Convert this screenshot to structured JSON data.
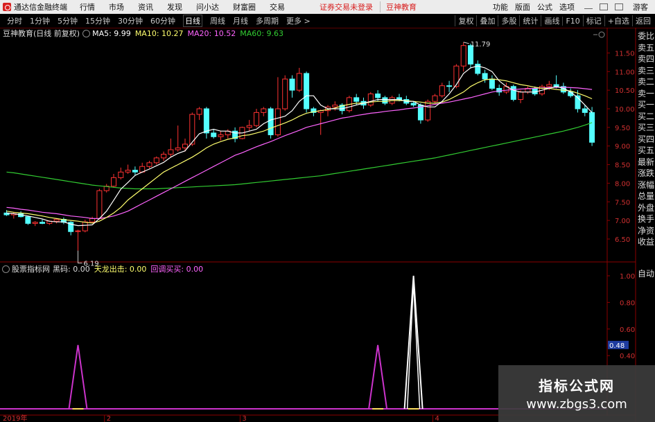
{
  "menubar": {
    "app_title": "通达信金融终端",
    "items": [
      "行情",
      "市场",
      "资讯",
      "发现",
      "问小达",
      "财富圈",
      "交易"
    ],
    "warning": "证券交易未登录",
    "brand": "豆神教育",
    "right_items": [
      "功能",
      "版面",
      "公式",
      "选项"
    ],
    "right_user": "游客"
  },
  "toolbar": {
    "periods": [
      "分时",
      "1分钟",
      "5分钟",
      "15分钟",
      "30分钟",
      "60分钟",
      "日线",
      "周线",
      "月线",
      "多周期",
      "更多 >"
    ],
    "active_period": "日线",
    "right": [
      "复权",
      "叠加",
      "多股",
      "统计",
      "画线",
      "F10",
      "标记",
      "+自选",
      "返回"
    ]
  },
  "infobar": {
    "stock": "豆神教育(日线 前复权)",
    "ma5": "MA5: 9.99",
    "ma10": "MA10: 10.27",
    "ma20": "MA20: 10.52",
    "ma60": "MA60: 9.63"
  },
  "indicator_bar": {
    "name": "股票指标网",
    "black_horse": "黑码: 0.00",
    "dragon": "天龙出击: 0.00",
    "pullback": "回调买买: 0.00"
  },
  "price_axis": [
    "11.50",
    "11.00",
    "10.50",
    "10.00",
    "9.50",
    "9.00",
    "8.50",
    "8.00",
    "7.50",
    "7.00",
    "6.50"
  ],
  "indicator_axis": [
    "1.00",
    "0.80",
    "0.60",
    "0.40"
  ],
  "indicator_marker": "0.48",
  "annotations": {
    "high": "11.79",
    "low": "6.19"
  },
  "date_axis": [
    "2019年",
    "2",
    "3",
    "4"
  ],
  "side_panel": [
    "委比",
    "卖五",
    "卖四",
    "卖三",
    "卖二",
    "卖一",
    "买一",
    "买二",
    "买三",
    "买四",
    "买五",
    "最新",
    "涨跌",
    "涨幅",
    "总量",
    "外盘",
    "换手",
    "净资",
    "收益"
  ],
  "auto_label": "自动",
  "watermark": {
    "title": "指标公式网",
    "url": "www.zbgs3.com"
  },
  "colors": {
    "up": "#ff3232",
    "down": "#54ffff",
    "ma5": "#ffffff",
    "ma10": "#ffff6e",
    "ma20": "#ff64ff",
    "ma60": "#32cd32",
    "signal_pink": "#cc33cc",
    "signal_white": "#ffffff"
  },
  "chart_data": {
    "type": "candlestick",
    "price_range": [
      6.2,
      11.95
    ],
    "candles": [
      {
        "o": 7.2,
        "h": 7.28,
        "l": 7.12,
        "c": 7.15
      },
      {
        "o": 7.15,
        "h": 7.22,
        "l": 7.05,
        "c": 7.18
      },
      {
        "o": 7.18,
        "h": 7.25,
        "l": 7.08,
        "c": 7.1
      },
      {
        "o": 7.1,
        "h": 7.12,
        "l": 6.88,
        "c": 6.92
      },
      {
        "o": 6.92,
        "h": 6.98,
        "l": 6.85,
        "c": 6.95
      },
      {
        "o": 6.95,
        "h": 7.02,
        "l": 6.9,
        "c": 6.92
      },
      {
        "o": 6.92,
        "h": 7.0,
        "l": 6.88,
        "c": 6.98
      },
      {
        "o": 6.98,
        "h": 7.05,
        "l": 6.92,
        "c": 7.03
      },
      {
        "o": 7.03,
        "h": 7.08,
        "l": 6.9,
        "c": 6.95
      },
      {
        "o": 6.95,
        "h": 6.98,
        "l": 6.6,
        "c": 6.7
      },
      {
        "o": 6.7,
        "h": 6.75,
        "l": 6.19,
        "c": 6.72
      },
      {
        "o": 6.72,
        "h": 7.02,
        "l": 6.68,
        "c": 6.96
      },
      {
        "o": 6.96,
        "h": 7.1,
        "l": 6.92,
        "c": 7.05
      },
      {
        "o": 7.05,
        "h": 7.85,
        "l": 7.02,
        "c": 7.8
      },
      {
        "o": 7.8,
        "h": 7.98,
        "l": 7.75,
        "c": 7.92
      },
      {
        "o": 7.92,
        "h": 8.25,
        "l": 7.88,
        "c": 8.15
      },
      {
        "o": 8.15,
        "h": 8.42,
        "l": 8.1,
        "c": 8.3
      },
      {
        "o": 8.3,
        "h": 8.5,
        "l": 8.25,
        "c": 8.35
      },
      {
        "o": 8.35,
        "h": 8.45,
        "l": 8.2,
        "c": 8.3
      },
      {
        "o": 8.3,
        "h": 8.55,
        "l": 8.28,
        "c": 8.45
      },
      {
        "o": 8.45,
        "h": 8.6,
        "l": 8.4,
        "c": 8.55
      },
      {
        "o": 8.55,
        "h": 8.72,
        "l": 8.5,
        "c": 8.68
      },
      {
        "o": 8.68,
        "h": 8.85,
        "l": 8.6,
        "c": 8.78
      },
      {
        "o": 8.78,
        "h": 9.2,
        "l": 8.7,
        "c": 8.9
      },
      {
        "o": 8.9,
        "h": 9.55,
        "l": 8.85,
        "c": 8.95
      },
      {
        "o": 8.95,
        "h": 9.2,
        "l": 8.85,
        "c": 9.05
      },
      {
        "o": 9.05,
        "h": 9.9,
        "l": 9.0,
        "c": 9.85
      },
      {
        "o": 9.85,
        "h": 10.05,
        "l": 9.7,
        "c": 10.0
      },
      {
        "o": 10.0,
        "h": 10.05,
        "l": 9.2,
        "c": 9.35
      },
      {
        "o": 9.35,
        "h": 9.45,
        "l": 9.2,
        "c": 9.25
      },
      {
        "o": 9.25,
        "h": 9.4,
        "l": 9.15,
        "c": 9.3
      },
      {
        "o": 9.3,
        "h": 9.45,
        "l": 9.2,
        "c": 9.4
      },
      {
        "o": 9.4,
        "h": 9.5,
        "l": 9.1,
        "c": 9.2
      },
      {
        "o": 9.2,
        "h": 9.52,
        "l": 9.18,
        "c": 9.5
      },
      {
        "o": 9.5,
        "h": 9.7,
        "l": 9.4,
        "c": 9.55
      },
      {
        "o": 9.55,
        "h": 10.0,
        "l": 9.5,
        "c": 9.9
      },
      {
        "o": 9.9,
        "h": 10.05,
        "l": 9.8,
        "c": 10.0
      },
      {
        "o": 10.0,
        "h": 10.05,
        "l": 9.2,
        "c": 9.3
      },
      {
        "o": 9.3,
        "h": 10.85,
        "l": 9.25,
        "c": 10.0
      },
      {
        "o": 10.0,
        "h": 10.9,
        "l": 9.95,
        "c": 10.8
      },
      {
        "o": 10.8,
        "h": 10.9,
        "l": 10.3,
        "c": 10.5
      },
      {
        "o": 10.5,
        "h": 11.1,
        "l": 10.45,
        "c": 10.95
      },
      {
        "o": 10.95,
        "h": 11.0,
        "l": 9.9,
        "c": 10.0
      },
      {
        "o": 10.0,
        "h": 10.05,
        "l": 9.8,
        "c": 9.9
      },
      {
        "o": 9.9,
        "h": 9.98,
        "l": 9.3,
        "c": 9.95
      },
      {
        "o": 9.95,
        "h": 10.1,
        "l": 9.8,
        "c": 10.05
      },
      {
        "o": 10.05,
        "h": 10.2,
        "l": 9.95,
        "c": 10.1
      },
      {
        "o": 10.1,
        "h": 10.15,
        "l": 9.85,
        "c": 9.95
      },
      {
        "o": 9.95,
        "h": 10.35,
        "l": 9.9,
        "c": 10.3
      },
      {
        "o": 10.3,
        "h": 10.4,
        "l": 10.1,
        "c": 10.2
      },
      {
        "o": 10.2,
        "h": 10.3,
        "l": 10.0,
        "c": 10.1
      },
      {
        "o": 10.1,
        "h": 10.45,
        "l": 10.05,
        "c": 10.4
      },
      {
        "o": 10.4,
        "h": 10.5,
        "l": 10.2,
        "c": 10.3
      },
      {
        "o": 10.3,
        "h": 10.35,
        "l": 10.1,
        "c": 10.15
      },
      {
        "o": 10.15,
        "h": 10.35,
        "l": 10.1,
        "c": 10.3
      },
      {
        "o": 10.3,
        "h": 10.4,
        "l": 10.2,
        "c": 10.25
      },
      {
        "o": 10.25,
        "h": 10.35,
        "l": 10.1,
        "c": 10.15
      },
      {
        "o": 10.15,
        "h": 10.2,
        "l": 10.05,
        "c": 10.1
      },
      {
        "o": 10.1,
        "h": 10.15,
        "l": 9.6,
        "c": 9.7
      },
      {
        "o": 9.7,
        "h": 10.25,
        "l": 9.65,
        "c": 10.2
      },
      {
        "o": 10.2,
        "h": 10.4,
        "l": 10.15,
        "c": 10.35
      },
      {
        "o": 10.35,
        "h": 10.7,
        "l": 10.3,
        "c": 10.62
      },
      {
        "o": 10.62,
        "h": 10.75,
        "l": 10.45,
        "c": 10.6
      },
      {
        "o": 10.6,
        "h": 11.2,
        "l": 10.55,
        "c": 11.15
      },
      {
        "o": 11.15,
        "h": 11.79,
        "l": 11.0,
        "c": 11.7
      },
      {
        "o": 11.7,
        "h": 11.75,
        "l": 11.1,
        "c": 11.2
      },
      {
        "o": 11.2,
        "h": 11.3,
        "l": 10.9,
        "c": 10.95
      },
      {
        "o": 10.95,
        "h": 11.05,
        "l": 10.7,
        "c": 10.8
      },
      {
        "o": 10.8,
        "h": 10.9,
        "l": 10.5,
        "c": 10.55
      },
      {
        "o": 10.55,
        "h": 10.65,
        "l": 10.35,
        "c": 10.45
      },
      {
        "o": 10.45,
        "h": 10.7,
        "l": 10.4,
        "c": 10.6
      },
      {
        "o": 10.6,
        "h": 10.65,
        "l": 10.2,
        "c": 10.25
      },
      {
        "o": 10.25,
        "h": 10.5,
        "l": 10.15,
        "c": 10.45
      },
      {
        "o": 10.45,
        "h": 10.6,
        "l": 10.4,
        "c": 10.55
      },
      {
        "o": 10.55,
        "h": 10.6,
        "l": 10.35,
        "c": 10.4
      },
      {
        "o": 10.4,
        "h": 10.65,
        "l": 10.35,
        "c": 10.6
      },
      {
        "o": 10.6,
        "h": 10.75,
        "l": 10.5,
        "c": 10.65
      },
      {
        "o": 10.65,
        "h": 10.9,
        "l": 10.55,
        "c": 10.6
      },
      {
        "o": 10.6,
        "h": 10.7,
        "l": 10.4,
        "c": 10.45
      },
      {
        "o": 10.45,
        "h": 10.55,
        "l": 10.3,
        "c": 10.35
      },
      {
        "o": 10.35,
        "h": 10.5,
        "l": 9.9,
        "c": 10.0
      },
      {
        "o": 10.0,
        "h": 10.1,
        "l": 9.8,
        "c": 9.9
      },
      {
        "o": 9.9,
        "h": 10.05,
        "l": 9.0,
        "c": 9.1
      }
    ],
    "ma5": [
      7.2,
      7.18,
      7.15,
      7.12,
      7.08,
      7.04,
      6.98,
      6.96,
      6.96,
      6.9,
      6.86,
      6.87,
      6.88,
      7.05,
      7.25,
      7.54,
      7.84,
      8.02,
      8.21,
      8.3,
      8.38,
      8.47,
      8.56,
      8.7,
      8.8,
      8.87,
      9.1,
      9.33,
      9.4,
      9.45,
      9.4,
      9.4,
      9.35,
      9.35,
      9.4,
      9.45,
      9.6,
      9.7,
      9.75,
      9.8,
      9.95,
      10.2,
      10.35,
      10.35,
      10.1,
      10.0,
      10.0,
      10.0,
      10.05,
      10.1,
      10.15,
      10.2,
      10.25,
      10.25,
      10.25,
      10.25,
      10.2,
      10.2,
      10.1,
      10.05,
      10.05,
      10.2,
      10.4,
      10.65,
      10.95,
      11.1,
      11.15,
      11.1,
      11.0,
      10.75,
      10.6,
      10.5,
      10.45,
      10.45,
      10.45,
      10.5,
      10.55,
      10.6,
      10.55,
      10.45,
      10.3,
      10.1,
      9.9
    ],
    "ma10": [
      7.25,
      7.22,
      7.2,
      7.18,
      7.15,
      7.12,
      7.08,
      7.05,
      7.02,
      7.0,
      6.98,
      6.95,
      6.93,
      6.98,
      7.08,
      7.2,
      7.35,
      7.55,
      7.7,
      7.85,
      8.0,
      8.15,
      8.3,
      8.4,
      8.5,
      8.6,
      8.7,
      8.82,
      8.95,
      9.05,
      9.12,
      9.18,
      9.22,
      9.28,
      9.3,
      9.35,
      9.4,
      9.48,
      9.55,
      9.62,
      9.7,
      9.8,
      9.88,
      9.92,
      9.95,
      9.98,
      10.02,
      10.08,
      10.12,
      10.15,
      10.15,
      10.18,
      10.2,
      10.2,
      10.22,
      10.22,
      10.22,
      10.2,
      10.18,
      10.15,
      10.15,
      10.18,
      10.25,
      10.35,
      10.45,
      10.6,
      10.7,
      10.78,
      10.8,
      10.78,
      10.75,
      10.7,
      10.65,
      10.62,
      10.58,
      10.55,
      10.55,
      10.52,
      10.5,
      10.48,
      10.42,
      10.35,
      10.27
    ],
    "ma20": [
      7.35,
      7.33,
      7.3,
      7.28,
      7.25,
      7.22,
      7.2,
      7.18,
      7.15,
      7.12,
      7.1,
      7.08,
      7.05,
      7.05,
      7.08,
      7.12,
      7.18,
      7.25,
      7.35,
      7.45,
      7.55,
      7.65,
      7.75,
      7.85,
      7.95,
      8.05,
      8.15,
      8.25,
      8.35,
      8.45,
      8.55,
      8.65,
      8.75,
      8.82,
      8.9,
      8.98,
      9.05,
      9.12,
      9.2,
      9.28,
      9.35,
      9.42,
      9.5,
      9.55,
      9.6,
      9.65,
      9.7,
      9.75,
      9.78,
      9.82,
      9.85,
      9.88,
      9.9,
      9.93,
      9.95,
      9.97,
      10.0,
      10.02,
      10.05,
      10.08,
      10.12,
      10.15,
      10.18,
      10.22,
      10.26,
      10.3,
      10.35,
      10.4,
      10.45,
      10.48,
      10.5,
      10.52,
      10.53,
      10.54,
      10.55,
      10.56,
      10.57,
      10.58,
      10.58,
      10.57,
      10.56,
      10.54,
      10.52
    ],
    "ma60": [
      8.3,
      8.28,
      8.25,
      8.22,
      8.19,
      8.16,
      8.13,
      8.1,
      8.07,
      8.04,
      8.01,
      7.98,
      7.95,
      7.93,
      7.91,
      7.89,
      7.87,
      7.86,
      7.85,
      7.85,
      7.85,
      7.85,
      7.86,
      7.87,
      7.88,
      7.89,
      7.9,
      7.91,
      7.92,
      7.93,
      7.94,
      7.95,
      7.96,
      7.98,
      8.0,
      8.02,
      8.04,
      8.06,
      8.08,
      8.1,
      8.12,
      8.14,
      8.16,
      8.18,
      8.2,
      8.23,
      8.26,
      8.29,
      8.32,
      8.35,
      8.38,
      8.41,
      8.44,
      8.47,
      8.5,
      8.53,
      8.56,
      8.59,
      8.62,
      8.65,
      8.68,
      8.72,
      8.76,
      8.8,
      8.84,
      8.88,
      8.92,
      8.96,
      9.0,
      9.04,
      9.08,
      9.12,
      9.16,
      9.2,
      9.24,
      9.28,
      9.32,
      9.36,
      9.4,
      9.45,
      9.5,
      9.56,
      9.63
    ],
    "signals": [
      {
        "index": 10,
        "value": 0.48,
        "color": "pink"
      },
      {
        "index": 52,
        "value": 0.48,
        "color": "pink"
      },
      {
        "index": 57,
        "value": 1.0,
        "color": "white"
      }
    ]
  }
}
